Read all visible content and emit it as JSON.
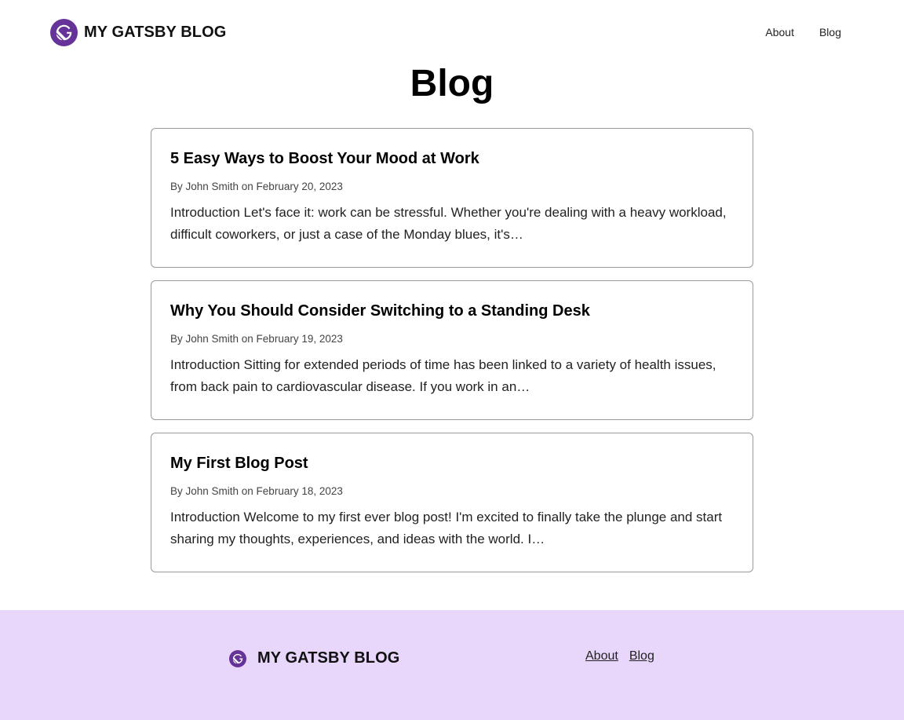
{
  "header": {
    "brand": "MY GATSBY BLOG",
    "logo_icon": "gatsby-logo-icon",
    "nav": [
      {
        "label": "About"
      },
      {
        "label": "Blog"
      }
    ]
  },
  "main": {
    "title": "Blog",
    "posts": [
      {
        "title": "5 Easy Ways to Boost Your Mood at Work",
        "meta": "By John Smith on February 20, 2023",
        "excerpt": "Introduction Let's face it: work can be stressful. Whether you're dealing with a heavy workload, difficult coworkers, or just a case of the Monday blues, it's…"
      },
      {
        "title": "Why You Should Consider Switching to a Standing Desk",
        "meta": "By John Smith on February 19, 2023",
        "excerpt": "Introduction Sitting for extended periods of time has been linked to a variety of health issues, from back pain to cardiovascular disease. If you work in an…"
      },
      {
        "title": "My First Blog Post",
        "meta": "By John Smith on February 18, 2023",
        "excerpt": "Introduction Welcome to my first ever blog post! I'm excited to finally take the plunge and start sharing my thoughts, experiences, and ideas with the world. I…"
      }
    ]
  },
  "footer": {
    "brand": "MY GATSBY BLOG",
    "nav": [
      {
        "label": "About"
      },
      {
        "label": "Blog"
      }
    ],
    "background": "#e8d6fb"
  },
  "colors": {
    "brand_purple": "#663399",
    "card_border": "#9a9a9a"
  }
}
